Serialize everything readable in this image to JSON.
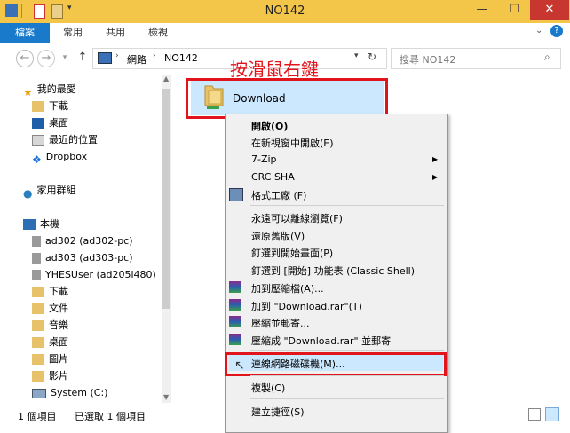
{
  "window": {
    "title": "NO142",
    "controls": [
      "—",
      "☐",
      "✕"
    ]
  },
  "ribbon": {
    "tabs": [
      "檔案",
      "常用",
      "共用",
      "檢視"
    ]
  },
  "address": {
    "path_root": "網路",
    "path_current": "NO142",
    "search_placeholder": "搜尋 NO142"
  },
  "sidebar": {
    "favorites_header": "我的最愛",
    "favorites": [
      "下載",
      "桌面",
      "最近的位置",
      "Dropbox"
    ],
    "homegroup": "家用群組",
    "this_pc": "本機",
    "pc_items": [
      "ad302 (ad302-pc)",
      "ad303 (ad303-pc)",
      "YHESUser (ad205l480)",
      "下載",
      "文件",
      "音樂",
      "桌面",
      "圖片",
      "影片",
      "System (C:)"
    ]
  },
  "content": {
    "item_name": "Download"
  },
  "annotation": "按滑鼠右鍵",
  "context_menu": {
    "items": [
      "開啟(O)",
      "在新視窗中開啟(E)",
      "7-Zip",
      "CRC SHA",
      "格式工廠 (F)",
      "永遠可以離線瀏覽(F)",
      "還原舊版(V)",
      "釘選到開始畫面(P)",
      "釘選到 [開始] 功能表 (Classic Shell)",
      "加到壓縮檔(A)...",
      "加到 \"Download.rar\"(T)",
      "壓縮並郵寄...",
      "壓縮成 \"Download.rar\" 並郵寄",
      "連線網路磁碟機(M)...",
      "複製(C)",
      "建立捷徑(S)"
    ]
  },
  "status": {
    "count": "1 個項目",
    "selected": "已選取 1 個項目"
  },
  "colors": {
    "titlebar": "#f3c64a",
    "file_tab": "#1979ca",
    "highlight_red": "#e1141b",
    "selection": "#cce8ff"
  }
}
